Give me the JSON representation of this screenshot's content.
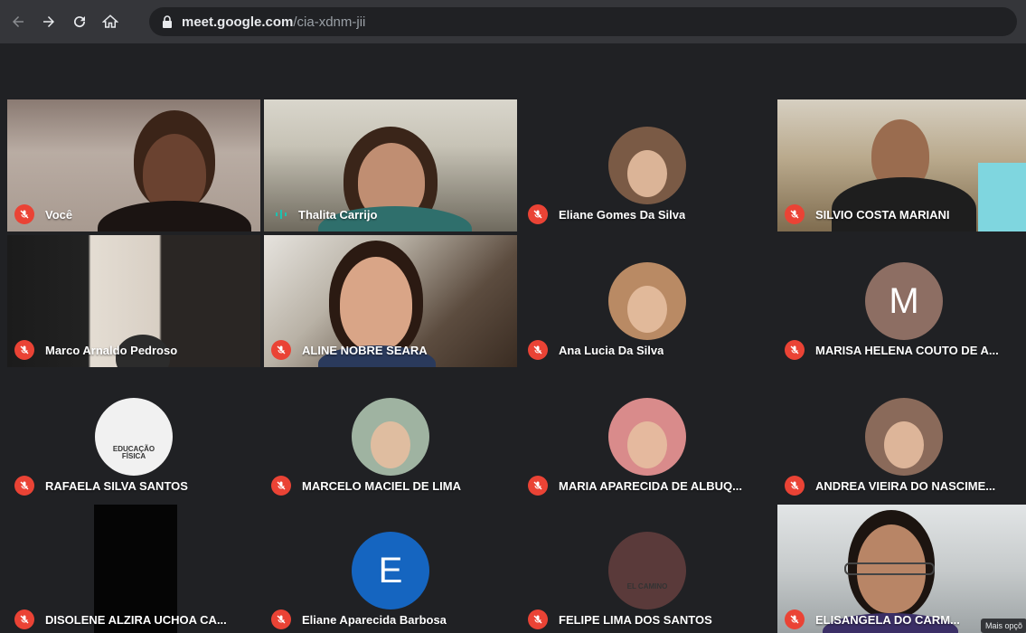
{
  "browser": {
    "url_host": "meet.google.com",
    "url_path": "/cia-xdnm-jii",
    "back_icon": "back-arrow-icon",
    "forward_icon": "forward-arrow-icon",
    "reload_icon": "reload-icon",
    "home_icon": "home-icon",
    "lock_icon": "lock-icon"
  },
  "participants": [
    {
      "name": "Você",
      "muted": true,
      "kind": "video",
      "video": "you"
    },
    {
      "name": "Thalita Carrijo",
      "muted": false,
      "speaking": true,
      "kind": "video",
      "video": "thalita"
    },
    {
      "name": "Eliane Gomes Da Silva",
      "muted": true,
      "kind": "photo",
      "avatar_color": "#7a5a45"
    },
    {
      "name": "SILVIO COSTA MARIANI",
      "muted": true,
      "kind": "video",
      "video": "silvio"
    },
    {
      "name": "Marco Arnaldo Pedroso",
      "muted": true,
      "kind": "video",
      "video": "marco"
    },
    {
      "name": "ALINE NOBRE SEARA",
      "muted": true,
      "kind": "video",
      "video": "aline"
    },
    {
      "name": "Ana Lucia Da Silva",
      "muted": true,
      "kind": "photo",
      "avatar_color": "#b98a64"
    },
    {
      "name": "MARISA HELENA COUTO DE A...",
      "muted": true,
      "kind": "letter",
      "letter": "M",
      "avatar_color": "#8d6e63"
    },
    {
      "name": "RAFAELA SILVA SANTOS",
      "muted": true,
      "kind": "photo",
      "avatar_color": "#f1f1f1",
      "avatar_text": "EDUCAÇÃO FÍSICA"
    },
    {
      "name": "MARCELO MACIEL DE LIMA",
      "muted": true,
      "kind": "photo",
      "avatar_color": "#9fb3a1"
    },
    {
      "name": "MARIA APARECIDA DE ALBUQ...",
      "muted": true,
      "kind": "photo",
      "avatar_color": "#d98b8b"
    },
    {
      "name": "ANDREA VIEIRA DO NASCIME...",
      "muted": true,
      "kind": "photo",
      "avatar_color": "#8a6a5a"
    },
    {
      "name": "DISOLENE ALZIRA UCHOA CA...",
      "muted": true,
      "kind": "dark"
    },
    {
      "name": "Eliane Aparecida Barbosa",
      "muted": true,
      "kind": "letter",
      "letter": "E",
      "avatar_color": "#1565c0"
    },
    {
      "name": "FELIPE LIMA DOS SANTOS",
      "muted": true,
      "kind": "photo",
      "avatar_color": "#5a3a3a",
      "avatar_text": "EL CAMINO"
    },
    {
      "name": "ELISANGELA DO CARM...",
      "muted": true,
      "kind": "video",
      "video": "elisangela",
      "hover_label": "Mais opçõ"
    }
  ],
  "icons": {
    "muted_mic": "mic-off-icon",
    "speaking": "audio-wave-icon"
  },
  "colors": {
    "background": "#202124",
    "muted_badge": "#ea4335",
    "speaking_accent": "#1cc3b0"
  }
}
